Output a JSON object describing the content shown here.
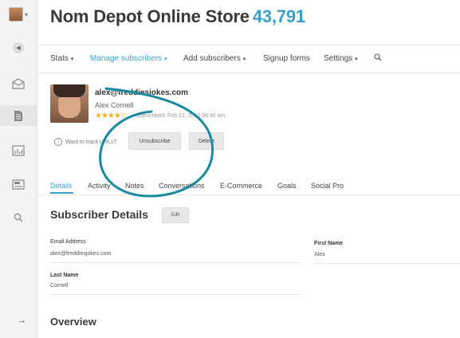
{
  "header": {
    "title": "Nom Depot Online Store",
    "count": "43,791"
  },
  "nav": {
    "stats": "Stats",
    "manage": "Manage subscribers",
    "add": "Add subscribers",
    "forms": "Signup forms",
    "settings": "Settings",
    "search_icon": "search-icon"
  },
  "subscriber": {
    "email": "alex@freddiesjokes.com",
    "name": "Alex Cornell",
    "stars": "★★★★☆",
    "rating": 4,
    "subscribed": "Subscribed: Feb 22, 2013 08:40 am"
  },
  "actions": {
    "track": "Want to track URLs?",
    "unsubscribe": "Unsubscribe",
    "delete": "Delete"
  },
  "tabs": [
    "Details",
    "Activity",
    "Notes",
    "Conversations",
    "E-Commerce",
    "Goals",
    "Social Pro"
  ],
  "details": {
    "title": "Subscriber Details",
    "edit": "Edit",
    "email_label": "Email Address",
    "email_value": "alex@freddiesjokes.com",
    "first_label": "First Name",
    "first_value": "Alex",
    "last_label": "Last Name",
    "last_value": "Cornell"
  },
  "overview": "Overview",
  "arrow": "→",
  "colors": {
    "accent": "#3aa0c8",
    "annotation": "#1a8aa3",
    "stars": "#f2b01e"
  }
}
